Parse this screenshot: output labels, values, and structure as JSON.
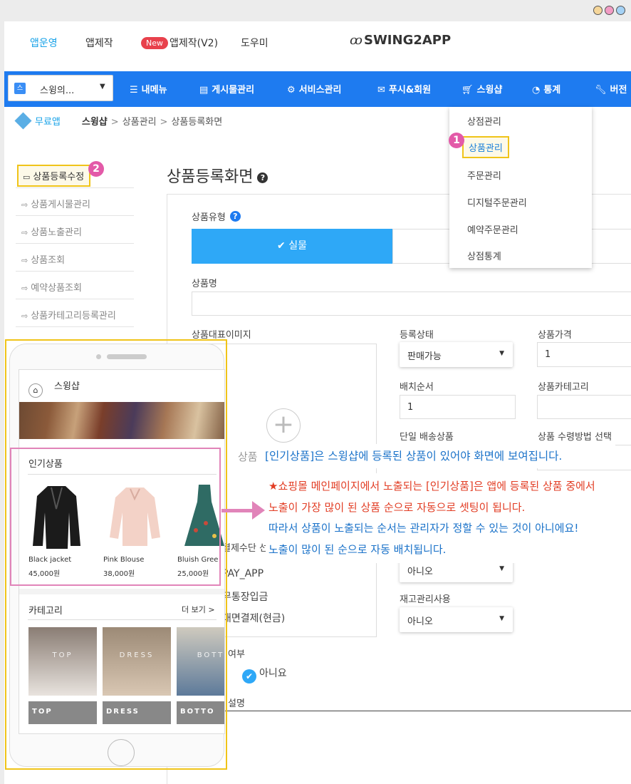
{
  "window": {
    "dot_colors": [
      "#f5d69a",
      "#f29cc4",
      "#a5d2f5"
    ]
  },
  "top_nav": {
    "items": [
      "앱운영",
      "앱제작",
      "앱제작(V2)",
      "도우미"
    ],
    "new_badge": "New",
    "logo": "SWING2APP"
  },
  "main_menu": {
    "app_select": "스윙의...",
    "items": [
      "내메뉴",
      "게시물관리",
      "서비스관리",
      "푸시&회원",
      "스윙샵",
      "통계",
      "버전"
    ]
  },
  "breadcrumb": {
    "plan": "무료앱",
    "path": [
      "스윙샵",
      "상품관리",
      "상품등록화면"
    ]
  },
  "sidebar": {
    "items": [
      "상품등록수정",
      "상품게시물관리",
      "상품노출관리",
      "상품조회",
      "예약상품조회",
      "상품카테고리등록관리"
    ]
  },
  "steps": {
    "step1": "1",
    "step2": "2"
  },
  "dropdown": {
    "items": [
      "상점관리",
      "상품관리",
      "주문관리",
      "디지털주문관리",
      "예약주문관리",
      "상점통계"
    ]
  },
  "form": {
    "title": "상품등록화면",
    "product_type_label": "상품유형",
    "type_real": "실물",
    "name_label": "상품명",
    "image_label": "상품대표이미지",
    "image_hint": "상품",
    "status_label": "등록상태",
    "status_value": "판매가능",
    "price_label": "상품가격",
    "price_value": "1",
    "order_label": "배치순서",
    "order_value": "1",
    "category_label": "상품카테고리",
    "single_ship_label": "단일 배송상품",
    "receive_label": "상품 수령방법 선택",
    "payment_label": "결제수단 선",
    "payment_options": [
      "PAY_APP",
      "무통장입금",
      "대면결제(현금)"
    ],
    "no_value": "아니오",
    "stock_label": "재고관리사용",
    "stock_value": "아니오",
    "flag_label": "여부",
    "flag_value": "아니요",
    "desc_label": "설명"
  },
  "phone": {
    "shop_title": "스윙샵",
    "popular_title": "인기상품",
    "products": [
      {
        "name": "Black jacket",
        "price": "45,000원"
      },
      {
        "name": "Pink Blouse",
        "price": "38,000원"
      },
      {
        "name": "Bluish Gree",
        "price": "25,000원"
      }
    ],
    "category_title": "카테고리",
    "more": "더 보기 >",
    "categories": [
      {
        "overlay": "TOP",
        "label": "TOP"
      },
      {
        "overlay": "DRESS",
        "label": "DRESS"
      },
      {
        "overlay": "BOTT",
        "label": "BOTTO"
      }
    ]
  },
  "callouts": {
    "note1": "[인기상품]은 스윙샵에 등록된 상품이 있어야 화면에 보여집니다.",
    "note2_lines": [
      "★쇼핑몰 메인페이지에서 노출되는 [인기상품]은 앱에 등록된 상품 중에서",
      "노출이 가장 많이 된 상품 순으로 자동으로 셋팅이 됩니다.",
      "따라서 상품이 노출되는 순서는 관리자가 정할 수 있는 것이 아니에요!",
      "노출이 많이 된 순으로 자동 배치됩니다."
    ]
  },
  "colors": {
    "brand_blue": "#1e7bf0",
    "accent_blue": "#2ea8f7",
    "highlight_yellow": "#f0c419",
    "step_pink": "#e35aa8",
    "callout_red": "#e23d24",
    "callout_blue": "#1a72c9"
  }
}
